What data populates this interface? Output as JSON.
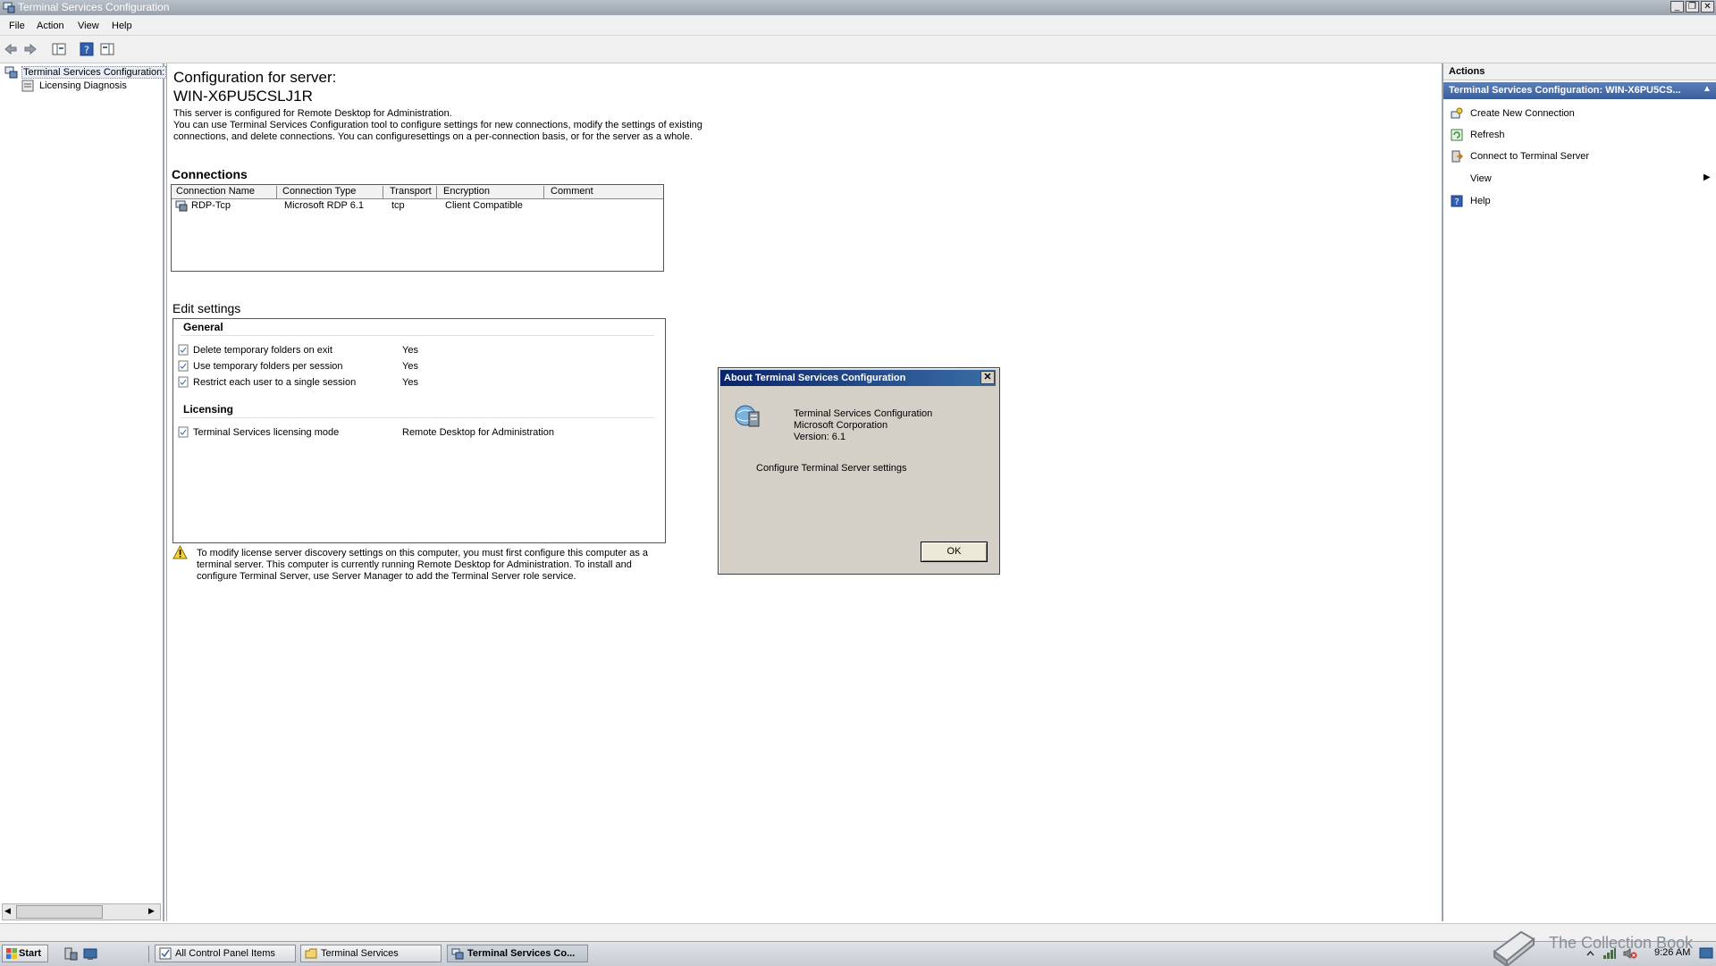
{
  "window": {
    "title": "Terminal Services Configuration",
    "buttons": [
      "_",
      "❐",
      "✕"
    ]
  },
  "menu": [
    "File",
    "Action",
    "View",
    "Help"
  ],
  "tree": {
    "root": "Terminal Services Configuration:",
    "child": "Licensing Diagnosis"
  },
  "main": {
    "heading_line1": "Configuration for server:",
    "heading_line2": "WIN-X6PU5CSLJ1R",
    "desc_line1": "This server is configured for Remote Desktop for Administration.",
    "desc_line2": "You can use Terminal Services Configuration tool to configure settings for new connections, modify the settings of existing",
    "desc_line3": "connections, and delete connections. You can configuresettings on a per-connection basis, or for the server as a whole.",
    "connections_title": "Connections",
    "columns": [
      "Connection Name",
      "Connection Type",
      "Transport",
      "Encryption",
      "Comment"
    ],
    "rows": [
      {
        "name": "RDP-Tcp",
        "type": "Microsoft RDP 6.1",
        "transport": "tcp",
        "encryption": "Client Compatible",
        "comment": ""
      }
    ],
    "edit_title": "Edit settings",
    "general_title": "General",
    "general_items": [
      {
        "label": "Delete temporary folders on exit",
        "value": "Yes"
      },
      {
        "label": "Use temporary folders per session",
        "value": "Yes"
      },
      {
        "label": "Restrict each user to a single session",
        "value": "Yes"
      }
    ],
    "licensing_title": "Licensing",
    "licensing_items": [
      {
        "label": "Terminal Services licensing mode",
        "value": "Remote Desktop for Administration"
      }
    ],
    "warning_line1": "To modify license server discovery settings on this computer, you must first configure this computer as a",
    "warning_line2": "terminal server. This computer is currently running Remote Desktop for Administration. To install and",
    "warning_line3": "configure Terminal Server, use Server Manager to add the Terminal Server role service."
  },
  "actions": {
    "title": "Actions",
    "section": "Terminal Services Configuration: WIN-X6PU5CS...",
    "items": [
      "Create New Connection",
      "Refresh",
      "Connect to Terminal Server",
      "View",
      "Help"
    ]
  },
  "dialog": {
    "title": "About Terminal Services Configuration",
    "product": "Terminal Services Configuration",
    "company": "Microsoft Corporation",
    "version": "Version: 6.1",
    "description": "Configure Terminal Server settings",
    "ok": "OK"
  },
  "taskbar": {
    "start": "Start",
    "buttons": [
      "All Control Panel Items",
      "Terminal Services",
      "Terminal Services Co..."
    ],
    "clock": "9:26 AM",
    "watermark": "The Collection Book"
  }
}
